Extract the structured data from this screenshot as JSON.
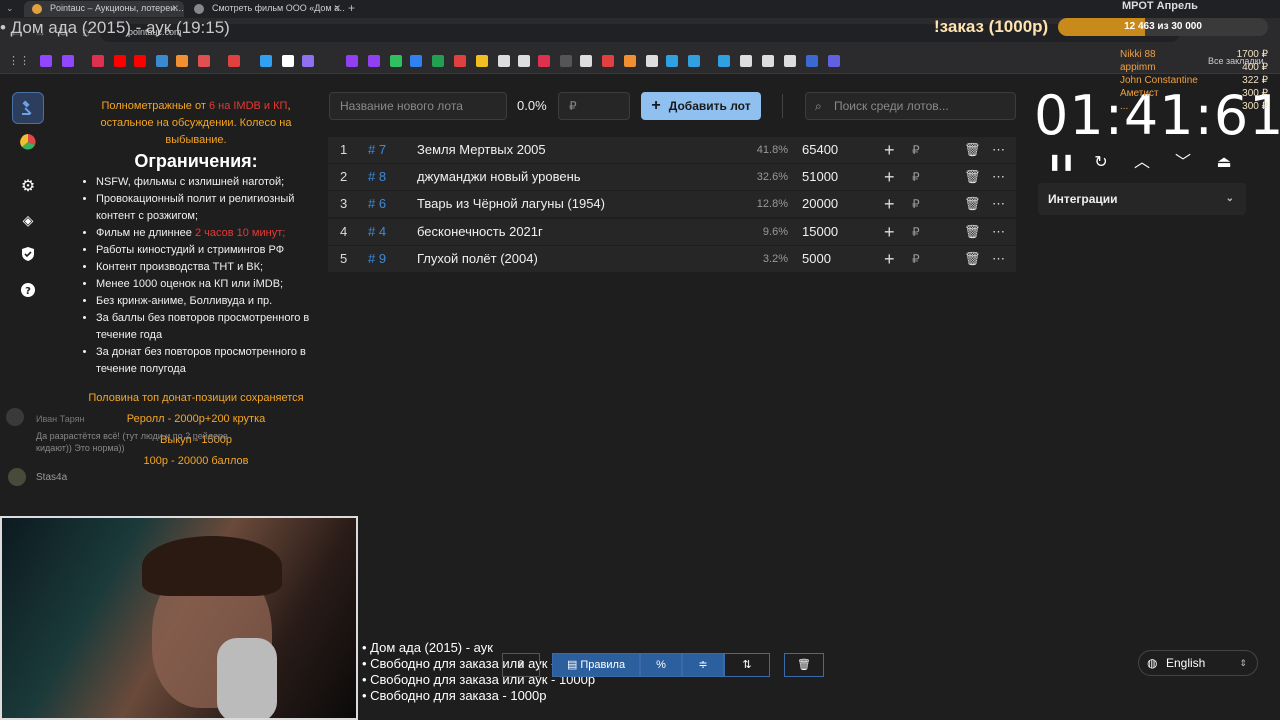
{
  "browser": {
    "tabs": [
      {
        "label": "Pointauc – Аукционы, лотереи…",
        "active": true
      },
      {
        "label": "Смотреть фильм ООО «Дом а…",
        "active": false
      }
    ],
    "url": "pointauc.com",
    "bookmarks_all_label": "Все закладки"
  },
  "stream": {
    "title_line": "• Дом ада (2015) - аук (19:15)",
    "order_banner": "!заказ (1000р)",
    "mrot_title": "МРОТ Апрель",
    "mrot_progress": "12 463  из 30 000",
    "mrot_fraction": 0.415,
    "donors": [
      {
        "name": "Nikki 88",
        "amount": "1700 ₽"
      },
      {
        "name": "appimm",
        "amount": "400 ₽"
      },
      {
        "name": "John Constantine",
        "amount": "322 ₽"
      },
      {
        "name": "Аметист",
        "amount": "300 ₽"
      },
      {
        "name": "...",
        "amount": "300 ₽"
      }
    ],
    "chat": [
      {
        "user": "Иван Тарян",
        "msg": "Да разрастётся всё! (тут люди и по 2 рейдера кидают)) Это норма))"
      },
      {
        "user": "Stas4a",
        "msg": ""
      }
    ],
    "bottom_list": [
      "• Дом ада (2015) - аук",
      "• Свободно для заказа или аук - 1000р",
      "• Свободно для заказа или аук - 1000р",
      "• Свободно для заказа - 1000р"
    ]
  },
  "rules": {
    "intro_orange_1": "Полнометражные от ",
    "intro_red": "6 на IMDB и КП",
    "intro_orange_2": ", остальное на обсуждении. Колесо на выбывание.",
    "heading": "Ограничения:",
    "items": [
      {
        "text": "NSFW, фильмы с излишней наготой;"
      },
      {
        "text": "Провокационный полит и религиозный контент с розжигом;"
      },
      {
        "text": "Фильм не длиннее ",
        "red": "2 часов 10 минут;"
      },
      {
        "text": "Работы киностудий и стримингов РФ"
      },
      {
        "text": "Контент производства ТНТ и ВК;"
      },
      {
        "text": "Менее 1000 оценок на КП или iMDB;"
      },
      {
        "text": "Без кринж-аниме, Болливуда и пр."
      },
      {
        "text": "За баллы без повторов просмотренного в течение года"
      },
      {
        "text": "За донат без повторов просмотренного в течение полугода"
      }
    ],
    "footer": [
      "Половина топ донат-позиции сохраняется",
      "Реролл - 2000р+200 крутка",
      "Выкуп - 1500р",
      "100р - 20000 баллов"
    ]
  },
  "controls": {
    "lot_name_placeholder": "Название нового лота",
    "percent": "0.0%",
    "amount_placeholder": "₽",
    "add_button": "Добавить лот",
    "search_placeholder": "Поиск среди лотов..."
  },
  "lots": [
    {
      "index": "1",
      "id": "# 7",
      "name": "Земля Мертвых 2005",
      "percent": "41.8%",
      "amount": "65400"
    },
    {
      "index": "2",
      "id": "# 8",
      "name": "джуманджи новый уровень",
      "percent": "32.6%",
      "amount": "51000"
    },
    {
      "index": "3",
      "id": "# 6",
      "name": "Тварь из Чёрной лагуны (1954)",
      "percent": "12.8%",
      "amount": "20000"
    },
    {
      "index": "4",
      "id": "# 4",
      "name": "бесконечность 2021г",
      "percent": "9.6%",
      "amount": "15000"
    },
    {
      "index": "5",
      "id": "# 9",
      "name": "Глухой полёт (2004)",
      "percent": "3.2%",
      "amount": "5000"
    }
  ],
  "currency_symbol": "₽",
  "timer": {
    "value": "01:41:61"
  },
  "integrations_label": "Интеграции",
  "toolbar": {
    "rules_label": "Правила"
  },
  "language": "English",
  "colors": {
    "accent": "#8fc0ef",
    "id_link": "#3d8bd9",
    "orange": "#f5a623",
    "red": "#e53935"
  }
}
